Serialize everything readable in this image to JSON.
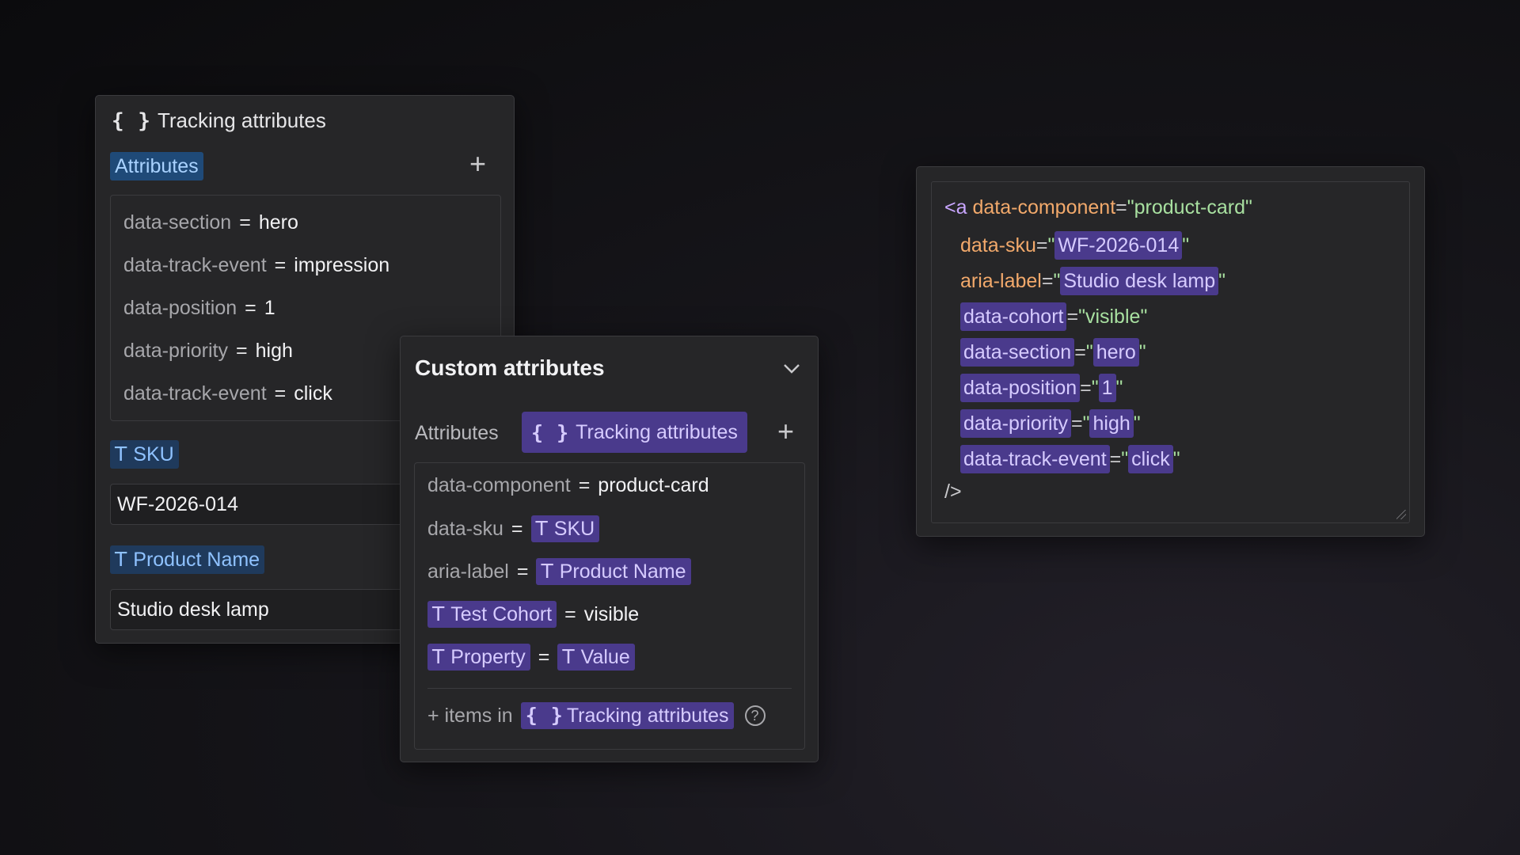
{
  "left_panel": {
    "title": "Tracking attributes",
    "attributes_label": "Attributes",
    "rows": [
      {
        "key": "data-section",
        "value": "hero"
      },
      {
        "key": "data-track-event",
        "value": "impression"
      },
      {
        "key": "data-position",
        "value": "1"
      },
      {
        "key": "data-priority",
        "value": "high"
      },
      {
        "key": "data-track-event",
        "value": "click"
      }
    ],
    "sku_label": "SKU",
    "sku_value": "WF-2026-014",
    "product_name_label": "Product Name",
    "product_name_value": "Studio desk lamp"
  },
  "custom_panel": {
    "title": "Custom attributes",
    "attributes_label": "Attributes",
    "active_tab": "Tracking attributes",
    "rows": [
      {
        "key": "data-component",
        "value": "product-card"
      },
      {
        "key": "data-sku",
        "value_chip": "SKU"
      },
      {
        "key": "aria-label",
        "value_chip": "Product Name"
      },
      {
        "key_chip": "Test Cohort",
        "value": "visible"
      },
      {
        "key_chip": "Property",
        "value_chip": "Value"
      }
    ],
    "items_prefix": "+ items in",
    "items_chip": "Tracking attributes",
    "help": "?"
  },
  "code": {
    "open": "<a",
    "close": "/>",
    "component_attr": "data-component",
    "component_val": "product-card",
    "sku_attr": "data-sku",
    "sku_val": "WF-2026-014",
    "aria_attr": "aria-label",
    "aria_val": "Studio desk lamp",
    "cohort_attr": "data-cohort",
    "cohort_val": "visible",
    "section_attr": "data-section",
    "section_val": "hero",
    "position_attr": "data-position",
    "position_val": "1",
    "priority_attr": "data-priority",
    "priority_val": "high",
    "track_attr": "data-track-event",
    "track_val": "click"
  },
  "icons": {
    "braces": "{ }",
    "text_type": "T",
    "plus": "+",
    "chevron": "chevron-down-icon"
  },
  "colors": {
    "chip_blue_bg": "#1f3a5c",
    "chip_blue_fg": "#8fc2ff",
    "chip_purple_bg": "#4a3a8c",
    "chip_purple_fg": "#d6cbff",
    "code_attr": "#f2a96b",
    "code_string": "#a8e0a0"
  }
}
